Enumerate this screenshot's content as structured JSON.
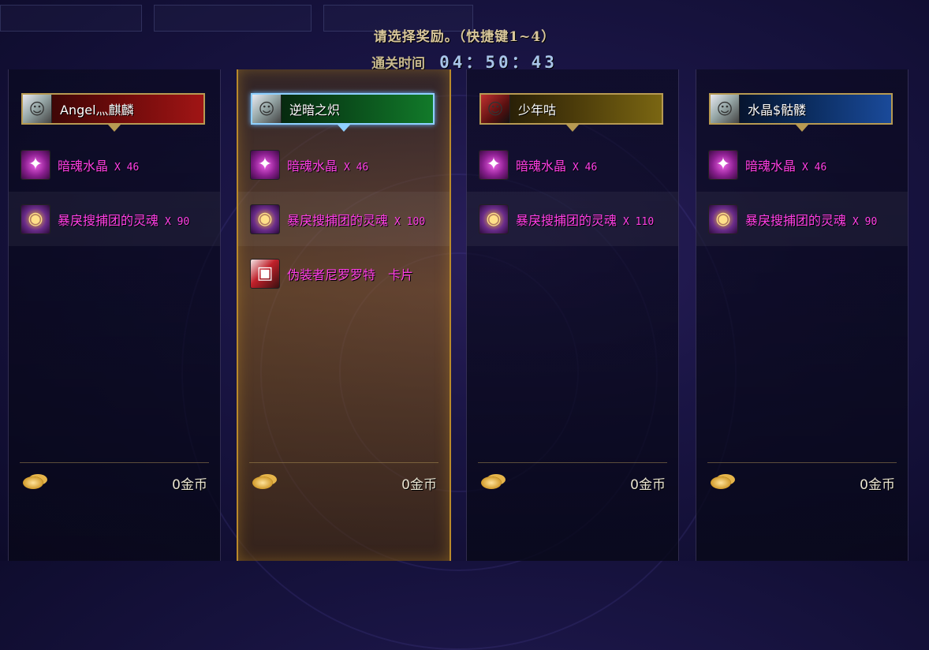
{
  "header": {
    "prompt": "请选择奖励。（快捷键1~4）",
    "timer_label": "通关时间",
    "timer_value": "04：50：43"
  },
  "colors": {
    "item_text": "#ff3fe6",
    "selected_border": "#b9892a"
  },
  "players": [
    {
      "name": "Angel灬麒麟",
      "bar_gradient": "linear-gradient(90deg, #2a0505 0%, #6a0a0a 50%, #a01515 100%)",
      "items": [
        {
          "icon": "crystal-icon",
          "name": "暗魂水晶",
          "qty": "X 46"
        },
        {
          "icon": "soul-icon",
          "name": "暴戾搜捕团的灵魂",
          "qty": "X 90"
        }
      ],
      "gold": "0金币"
    },
    {
      "name": "逆暗之炽",
      "selected": true,
      "bar_gradient": "linear-gradient(90deg, #051a0a 0%, #0a4a1a 50%, #127a2a 100%)",
      "items": [
        {
          "icon": "crystal-icon",
          "name": "暗魂水晶",
          "qty": "X 46"
        },
        {
          "icon": "soul-icon",
          "name": "暴戾搜捕团的灵魂",
          "qty": "X 100"
        },
        {
          "icon": "card-icon",
          "name": "伪装者尼罗罗特　卡片",
          "qty": ""
        }
      ],
      "gold": "0金币"
    },
    {
      "name": "少年咕",
      "bar_gradient": "linear-gradient(90deg, #1a1405 0%, #4a3a0a 50%, #7a6612 100%)",
      "items": [
        {
          "icon": "crystal-icon",
          "name": "暗魂水晶",
          "qty": "X 46"
        },
        {
          "icon": "soul-icon",
          "name": "暴戾搜捕团的灵魂",
          "qty": "X 110"
        }
      ],
      "gold": "0金币"
    },
    {
      "name": "水晶$骷髅",
      "bar_gradient": "linear-gradient(90deg, #050a1a 0%, #0a2a5a 50%, #1a4a9a 100%)",
      "items": [
        {
          "icon": "crystal-icon",
          "name": "暗魂水晶",
          "qty": "X 46"
        },
        {
          "icon": "soul-icon",
          "name": "暴戾搜捕团的灵魂",
          "qty": "X 90"
        }
      ],
      "gold": "0金币"
    }
  ]
}
